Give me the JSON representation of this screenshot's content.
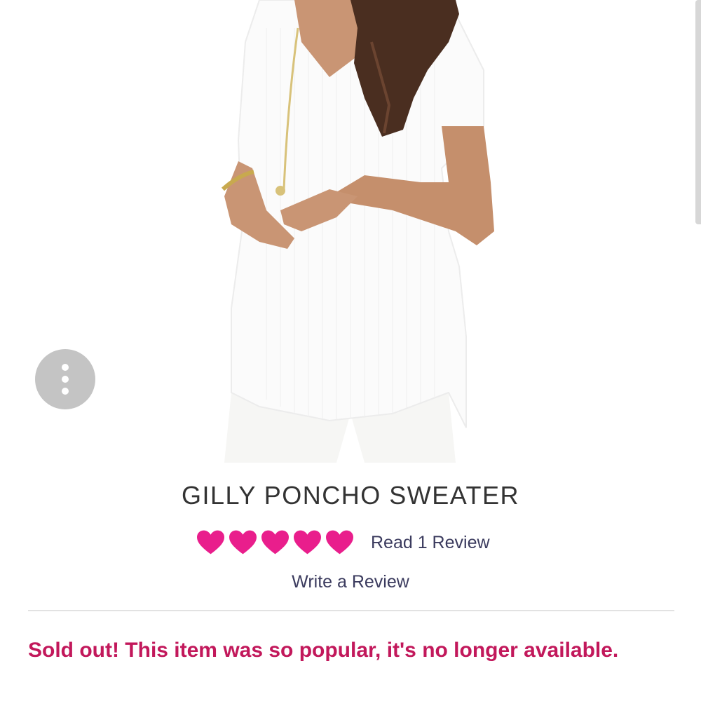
{
  "product": {
    "title": "GILLY PONCHO SWEATER",
    "rating": 5,
    "rating_max": 5,
    "read_review_label": "Read 1 Review",
    "write_review_label": "Write a Review",
    "sold_out_message": "Sold out! This item was so popular, it's no longer available."
  },
  "icons": {
    "more_options": "more-vertical-icon",
    "rating": "heart-icon"
  },
  "colors": {
    "heart": "#e91e8c",
    "link_text": "#3b3b5e",
    "title_text": "#333333",
    "sold_out": "#c2185b",
    "more_button_bg": "#c4c4c4"
  }
}
